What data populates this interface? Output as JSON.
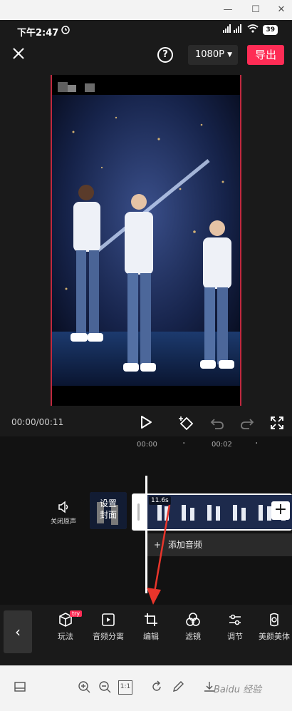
{
  "window": {
    "minimize": "—",
    "maximize": "☐",
    "close": "✕"
  },
  "status": {
    "time": "下午2:47",
    "signal": "4G",
    "battery": "39"
  },
  "topbar": {
    "resolution": "1080P",
    "export_label": "导出",
    "help": "?"
  },
  "player": {
    "time_readout": "00:00/00:11"
  },
  "timeline": {
    "ruler_marks": [
      "00:00",
      "00:02"
    ],
    "mute_label": "关闭原声",
    "cover_label_line1": "设置",
    "cover_label_line2": "封面",
    "clip_duration": "11.6s",
    "add_audio_label": "添加音频"
  },
  "toolbar": {
    "items": [
      {
        "label": "玩法",
        "badge": "try"
      },
      {
        "label": "音频分离"
      },
      {
        "label": "编辑"
      },
      {
        "label": "滤镜"
      },
      {
        "label": "调节"
      },
      {
        "label": "美颜美体"
      }
    ]
  },
  "bottombar": {
    "zoom_reset": "1:1",
    "watermark": "Baidu 经验"
  },
  "colors": {
    "accent": "#fe2c55",
    "arrow": "#e8352b",
    "background": "#1a1a1a"
  }
}
